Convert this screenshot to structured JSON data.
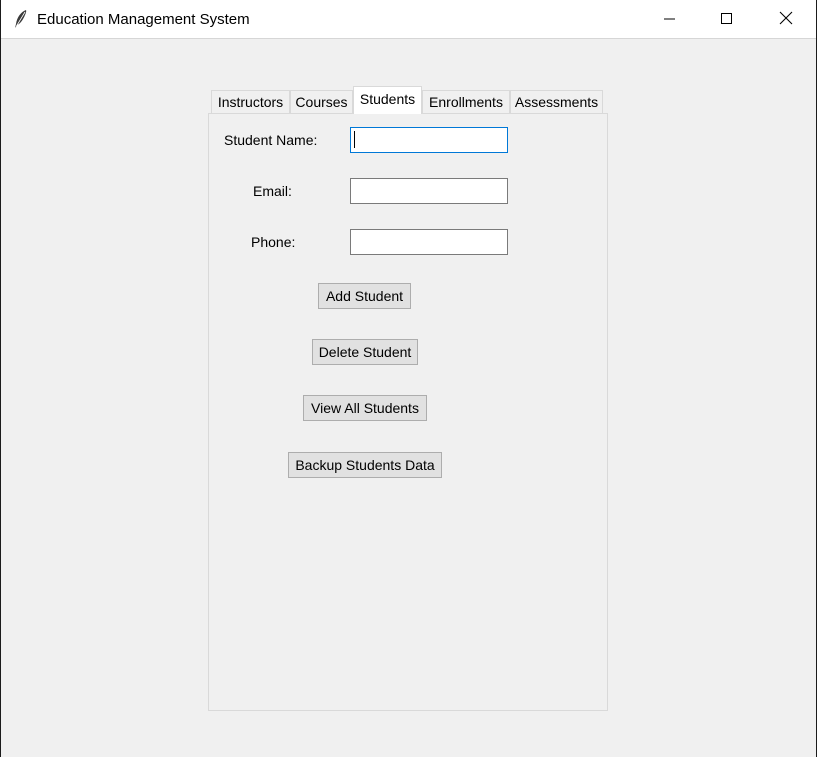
{
  "window": {
    "title": "Education Management System",
    "app_icon": "feather-icon",
    "controls": {
      "minimize_icon": "minimize-icon",
      "maximize_icon": "maximize-icon",
      "close_icon": "close-icon"
    }
  },
  "tabs": [
    {
      "label": "Instructors",
      "selected": false
    },
    {
      "label": "Courses",
      "selected": false
    },
    {
      "label": "Students",
      "selected": true
    },
    {
      "label": "Enrollments",
      "selected": false
    },
    {
      "label": "Assessments",
      "selected": false
    }
  ],
  "form": {
    "student_name_label": "Student Name:",
    "student_name_value": "",
    "email_label": "Email:",
    "email_value": "",
    "phone_label": "Phone:",
    "phone_value": ""
  },
  "buttons": {
    "add": "Add Student",
    "delete": "Delete Student",
    "view_all": "View All Students",
    "backup": "Backup Students Data"
  },
  "colors": {
    "window_bg": "#f0f0f0",
    "focus_border": "#0078d7",
    "button_bg": "#e1e1e1"
  }
}
